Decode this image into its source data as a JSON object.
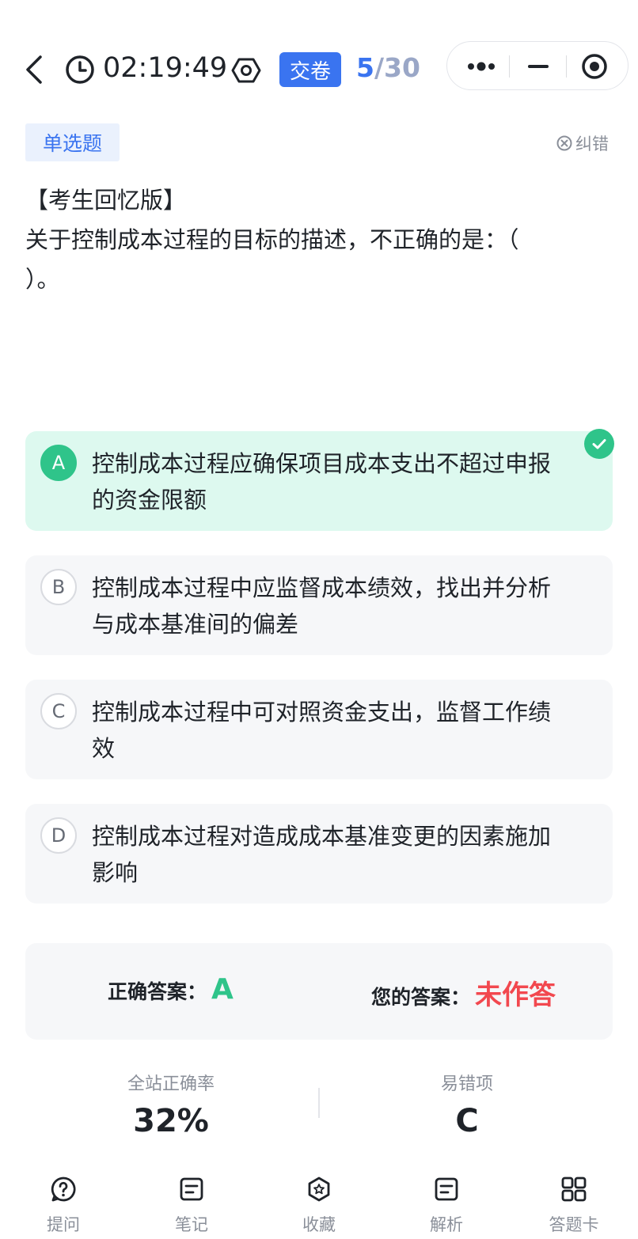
{
  "header": {
    "timer": "02:19:49",
    "submit_label": "交卷",
    "progress_current": "5",
    "progress_separator": "/",
    "progress_total": "30"
  },
  "question": {
    "type_label": "单选题",
    "report_label": "纠错",
    "lines": [
      "【考生回忆版】",
      "关于控制成本过程的目标的描述，不正确的是：（",
      "）。"
    ]
  },
  "options": [
    {
      "letter": "A",
      "lines": [
        "控制成本过程应确保项目成本支出不超过申报",
        "的资金限额"
      ],
      "is_correct": true
    },
    {
      "letter": "B",
      "lines": [
        "控制成本过程中应监督成本绩效，找出并分析",
        "与成本基准间的偏差"
      ],
      "is_correct": false
    },
    {
      "letter": "C",
      "lines": [
        "控制成本过程中可对照资金支出，监督工作绩",
        "效"
      ],
      "is_correct": false
    },
    {
      "letter": "D",
      "lines": [
        "控制成本过程对造成成本基准变更的因素施加",
        "影响"
      ],
      "is_correct": false
    }
  ],
  "answer": {
    "correct_label": "正确答案：",
    "correct_value": "A",
    "user_label": "您的答案：",
    "user_value": "未作答"
  },
  "stats": {
    "accuracy_label": "全站正确率",
    "accuracy_value": "32%",
    "common_wrong_label": "易错项",
    "common_wrong_value": "C"
  },
  "nav": [
    {
      "label": "提问",
      "icon": "question-icon"
    },
    {
      "label": "笔记",
      "icon": "note-icon"
    },
    {
      "label": "收藏",
      "icon": "star-icon"
    },
    {
      "label": "解析",
      "icon": "analysis-icon"
    },
    {
      "label": "答题卡",
      "icon": "grid-icon"
    }
  ],
  "colors": {
    "accent": "#3a74f0",
    "correct": "#2fc48a",
    "wrong": "#f2484f"
  }
}
